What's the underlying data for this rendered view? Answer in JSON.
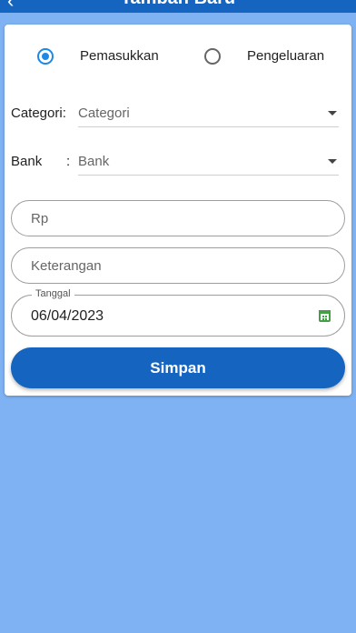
{
  "appbar": {
    "title": "Tambah Baru",
    "back_icon": "back-arrow-icon"
  },
  "type_options": [
    {
      "label": "Pemasukkan",
      "checked": true
    },
    {
      "label": "Pengeluaran",
      "checked": false
    }
  ],
  "category": {
    "label": "Categori:",
    "placeholder": "Categori"
  },
  "bank": {
    "label": "Bank",
    "colon": ":",
    "placeholder": "Bank"
  },
  "amount": {
    "placeholder": "Rp"
  },
  "note": {
    "placeholder": "Keterangan"
  },
  "date": {
    "label": "Tanggal",
    "value": "06/04/2023",
    "icon": "calendar-icon"
  },
  "save_label": "Simpan",
  "colors": {
    "primary": "#1565c0",
    "accent": "#1e88e5",
    "background": "#7fb2f3",
    "calendar_icon": "#43a047"
  }
}
